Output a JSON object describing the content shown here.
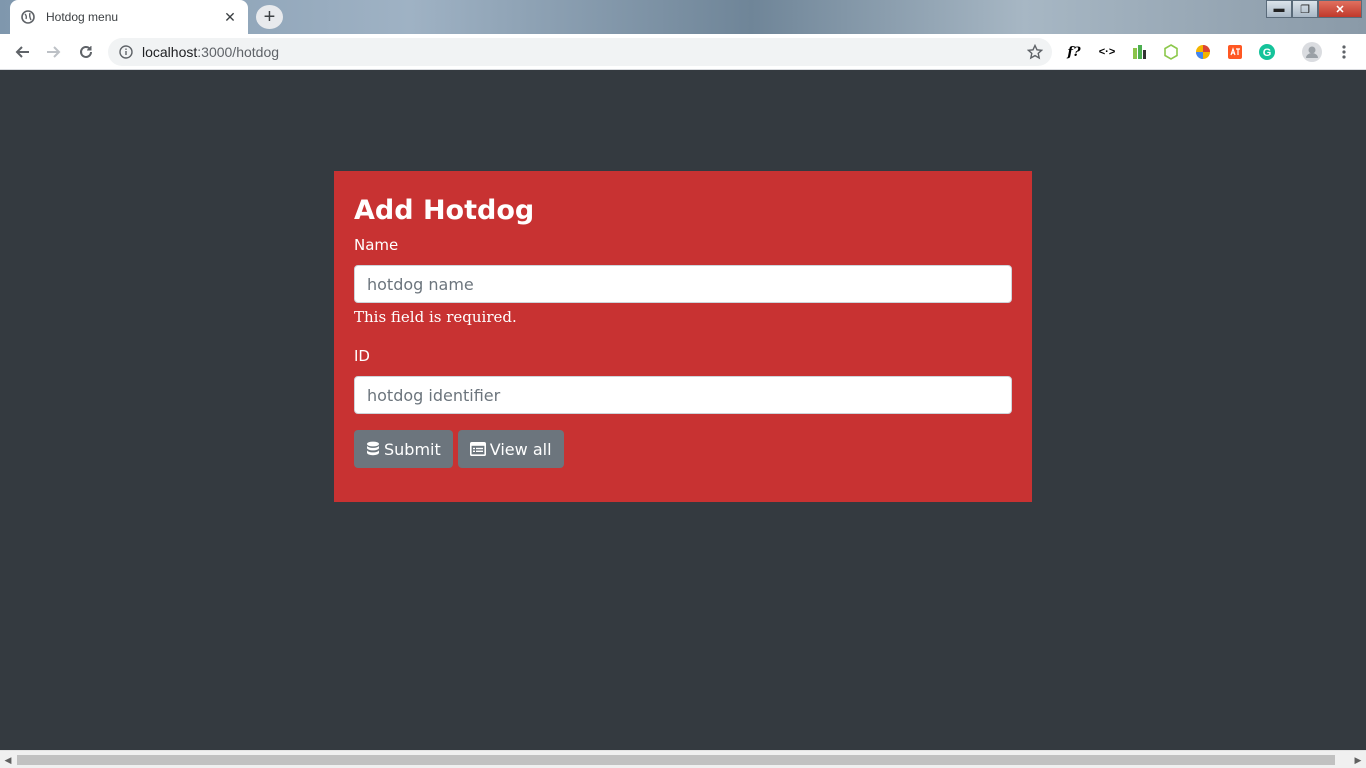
{
  "browser": {
    "tab_title": "Hotdog menu",
    "tab_close": "✕",
    "new_tab": "+",
    "url_host": "localhost",
    "url_rest": ":3000/hotdog",
    "extensions": [
      "f?",
      "<·>",
      "",
      "",
      "",
      "",
      "G"
    ],
    "window_controls": {
      "minimize": "▬",
      "maximize": "❐",
      "close": "✕"
    }
  },
  "form": {
    "title": "Add Hotdog",
    "name_label": "Name",
    "name_placeholder": "hotdog name",
    "name_error": "This field is required.",
    "id_label": "ID",
    "id_placeholder": "hotdog identifier",
    "submit_label": "Submit",
    "view_all_label": "View all"
  },
  "colors": {
    "page_bg": "#343a40",
    "card_bg": "#c83232",
    "button_bg": "#6c757d"
  },
  "icons": {
    "submit": "database-icon",
    "view_all": "list-alt-icon"
  }
}
